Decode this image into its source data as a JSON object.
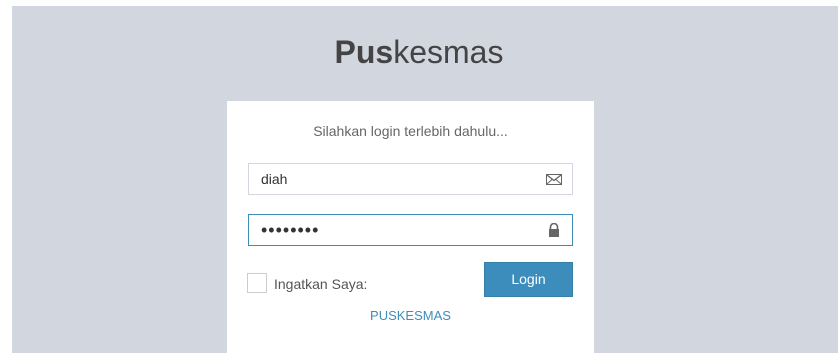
{
  "app": {
    "title_bold": "Pus",
    "title_rest": "kesmas"
  },
  "login": {
    "message": "Silahkan login terlebih dahulu...",
    "username": {
      "value": "diah",
      "icon": "envelope-icon"
    },
    "password": {
      "value": "12345678",
      "icon": "lock-icon"
    },
    "remember_label": "Ingatkan Saya:",
    "remember_checked": false,
    "submit_label": "Login",
    "footer_link": "PUSKESMAS"
  },
  "colors": {
    "page_background": "#d2d6de",
    "accent": "#3c8dbc",
    "box_background": "#ffffff"
  }
}
